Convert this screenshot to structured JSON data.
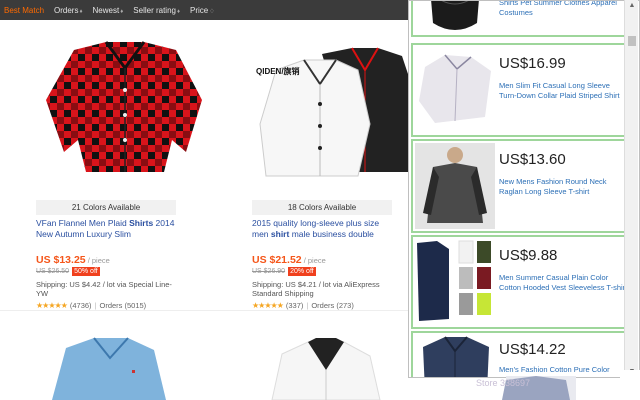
{
  "sortbar": {
    "options": [
      {
        "label": "Best Match",
        "arrow": ""
      },
      {
        "label": "Orders",
        "arrow": "♦"
      },
      {
        "label": "Newest",
        "arrow": "♦"
      },
      {
        "label": "Seller rating",
        "arrow": "♦"
      },
      {
        "label": "Price",
        "arrow": "♢"
      }
    ]
  },
  "products": [
    {
      "colors": "21 Colors Available",
      "title_pre": "VFan Flannel Men Plaid ",
      "title_bold": "Shirts",
      "title_post": " 2014 New Autumn Luxury Slim",
      "price": "US $13.25",
      "unit": " / piece",
      "old_price": "US $26.50",
      "discount": "50% off",
      "shipping": "Shipping: US $4.42 / lot via Special Line-YW",
      "stars": "★★★★★",
      "reviews": "(4736)",
      "orders": "Orders (5015)"
    },
    {
      "brand": "QIDEN/旗销",
      "colors": "18 Colors Available",
      "title_pre": "2015 quality long-sleeve plus size men ",
      "title_bold": "shirt",
      "title_post": " male business double",
      "price": "US $21.52",
      "unit": " / piece",
      "old_price": "US $26.90",
      "discount": "20% off",
      "shipping": "Shipping: US $4.21 / lot via AliExpress Standard Shipping",
      "stars": "★★★★★",
      "reviews": "(337)",
      "orders": "Orders (273)"
    }
  ],
  "panel": {
    "items": [
      {
        "price": "",
        "title": "Shirts Pet Summer Clothes Apparel Costumes"
      },
      {
        "price": "US$16.99",
        "title": "Men Slim Fit Casual Long Sleeve Turn-Down Collar Plaid Striped Shirt"
      },
      {
        "price": "US$13.60",
        "title": "New Mens Fashion Round Neck Raglan Long Sleeve T-shirt"
      },
      {
        "price": "US$9.88",
        "title": "Men Summer Casual Plain Color Cotton Hooded Vest Sleeveless T-shirt"
      },
      {
        "price": "US$14.22",
        "title": "Men's Fashion Cotton Pure Color"
      }
    ]
  },
  "watermark": "Store 338697",
  "colors": {
    "accent": "#ff6a00",
    "price": "#f5561a",
    "link": "#2a4fa0",
    "panel_border": "#9ed69b"
  }
}
